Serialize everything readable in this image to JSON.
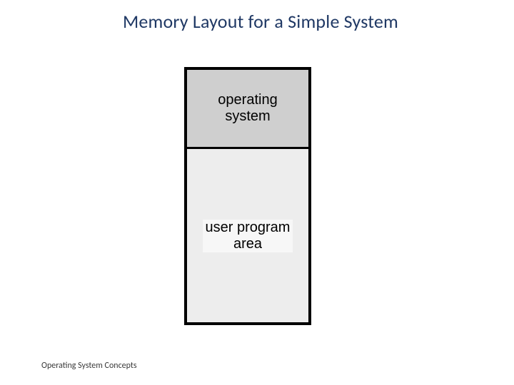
{
  "title": "Memory Layout for a Simple System",
  "blocks": {
    "os": "operating\nsystem",
    "user": "user program\narea"
  },
  "footer": "Operating System Concepts"
}
